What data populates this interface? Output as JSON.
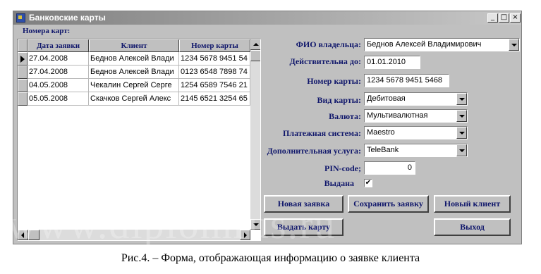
{
  "window": {
    "title": "Банковские карты",
    "minimize": "_",
    "maximize": "□",
    "close": "×"
  },
  "grid": {
    "label": "Номера карт:",
    "columns": [
      "Дата заявки",
      "Клиент",
      "Номер карты"
    ],
    "rows": [
      [
        "27.04.2008",
        "Беднов Алексей Влади",
        "1234 5678 9451 54"
      ],
      [
        "27.04.2008",
        "Беднов Алексей Влади",
        "0123 6548 7898 74"
      ],
      [
        "04.05.2008",
        "Чекалин Сергей Серге",
        "1254 6589 7546 21"
      ],
      [
        "05.05.2008",
        "Скачков Сергей Алекс",
        "2145 6521 3254 65"
      ]
    ],
    "current_row": 0
  },
  "form": {
    "owner_label": "ФИО владельца:",
    "owner_value": "Беднов Алексей Владимирович",
    "valid_label": "Действительна до:",
    "valid_value": "01.01.2010",
    "card_no_label": "Номер карты:",
    "card_no_value": "1234 5678 9451 5468",
    "card_type_label": "Вид карты:",
    "card_type_value": "Дебитовая",
    "currency_label": "Валюта:",
    "currency_value": "Мультивалютная",
    "payment_system_label": "Платежная система:",
    "payment_system_value": "Maestro",
    "extra_service_label": "Дополнительная услуга:",
    "extra_service_value": "TeleBank",
    "pin_label": "PIN-code;",
    "pin_value": "0",
    "issued_label": "Выдана",
    "issued_checked": true
  },
  "buttons": {
    "new_request": "Новая заявка",
    "save_request": "Сохранить заявку",
    "new_client": "Новый клиент",
    "issue_card": "Выдать карту",
    "exit": "Выход"
  },
  "caption": "Рис.4. – Форма, отображающая информацию о заявке клиента",
  "watermark": "www.diplomrus.ru",
  "colors": {
    "label": "#10176b",
    "window_bg": "#c0c0c0",
    "titlebar_start": "#7f7f7f"
  }
}
